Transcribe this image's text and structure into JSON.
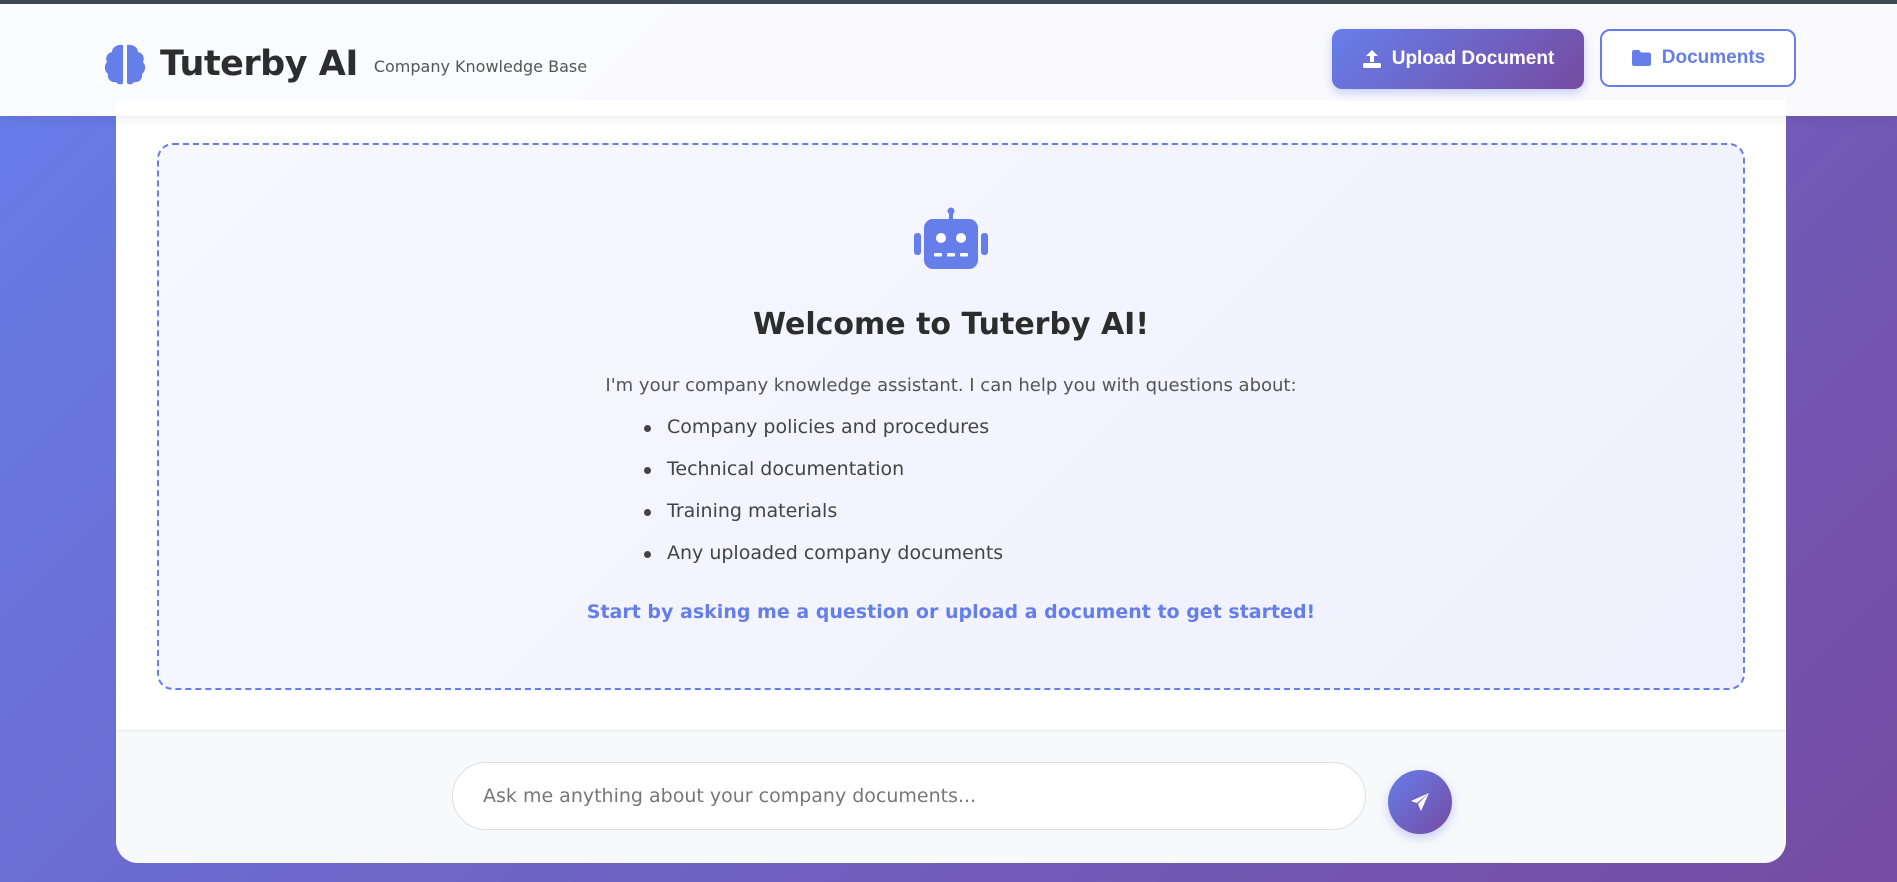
{
  "header": {
    "title": "Tuterby AI",
    "subtitle": "Company Knowledge Base",
    "logo_icon": "brain-icon",
    "upload_label": "Upload Document",
    "upload_icon": "upload-icon",
    "documents_label": "Documents",
    "documents_icon": "folder-icon"
  },
  "welcome": {
    "icon": "robot-icon",
    "title": "Welcome to Tuterby AI!",
    "intro": "I'm your company knowledge assistant. I can help you with questions about:",
    "topics": [
      "Company policies and procedures",
      "Technical documentation",
      "Training materials",
      "Any uploaded company documents"
    ],
    "cta": "Start by asking me a question or upload a document to get started!"
  },
  "chat": {
    "placeholder": "Ask me anything about your company documents...",
    "value": "",
    "send_icon": "paper-plane-icon"
  },
  "colors": {
    "accent": "#667eea",
    "accent_dark": "#764ba2",
    "text": "#2d2d2d"
  }
}
